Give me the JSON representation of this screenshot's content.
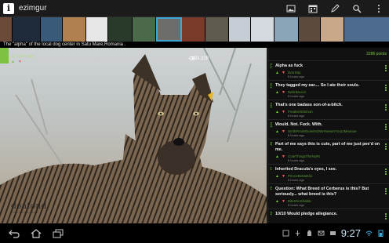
{
  "app": {
    "title": "ezimgur",
    "icon_letter": "i"
  },
  "actions": [
    {
      "name": "gallery-icon"
    },
    {
      "name": "calendar-icon"
    },
    {
      "name": "edit-icon"
    },
    {
      "name": "search-icon"
    },
    {
      "name": "overflow-menu-icon"
    }
  ],
  "thumbnails": [
    {
      "color": "#6b4a3a"
    },
    {
      "color": "#1f2a3a"
    },
    {
      "color": "#3a5a7a"
    },
    {
      "color": "#b08050"
    },
    {
      "color": "#e6e6e6"
    },
    {
      "color": "#2a3a2a"
    },
    {
      "color": "#4a6a4a"
    },
    {
      "color": "#6d6e6a",
      "selected": true
    },
    {
      "color": "#7a3a2a"
    },
    {
      "color": "#5e5a4e"
    },
    {
      "color": "#c7cdd4"
    },
    {
      "color": "#d4dae0"
    },
    {
      "color": "#8aa4b8"
    },
    {
      "color": "#5c4a3e"
    },
    {
      "color": "#c9a88a"
    },
    {
      "color": "#4d6b8e"
    }
  ],
  "image": {
    "caption": "The \"alpha\" of the local dog center in Satu Mare,Romania .",
    "posted": "12 hours ago",
    "views": "493,228",
    "watermark": "doatond",
    "watermark_sub": "PHOTOGRAPHY"
  },
  "comments": {
    "points_label": "2286 points",
    "items": [
      {
        "pts": "773",
        "text": "Alpha as fuck",
        "user": "dvorSay",
        "time": "6 hours ago"
      },
      {
        "pts": "376",
        "text": "They tagged my ear.... So I ate their souls.",
        "user": "NahrdaLion",
        "time": "6 hours ago"
      },
      {
        "pts": "321",
        "text": "That's one badass son-of-a-bitch.",
        "user": "FreakerStitchon",
        "time": "6 hours ago"
      },
      {
        "pts": "164",
        "text": "Would. Not. Fuck. With.",
        "user": "SmthPinoleDoesNOWANewerYouLtMeasue",
        "time": "6 hours ago"
      },
      {
        "pts": "89",
        "text": "Part of me says this is cute, part of me just pee'd on me.",
        "user": "CuteThingsTheNoRt",
        "time": "6 hours ago"
      },
      {
        "pts": "77",
        "text": "Inherited Dracula's eyes, I see.",
        "user": "PrinceBeMaNiu",
        "time": "6 hours ago"
      },
      {
        "pts": "73",
        "text": "Question: What Breed of Cerberus is this? But seriously... what breed is this?",
        "user": "BiteShoShable",
        "time": "6 hours ago"
      },
      {
        "pts": "64",
        "text": "10/10 Would pledge allegiance.",
        "user": "",
        "time": ""
      }
    ]
  },
  "status": {
    "time": "9:27"
  }
}
